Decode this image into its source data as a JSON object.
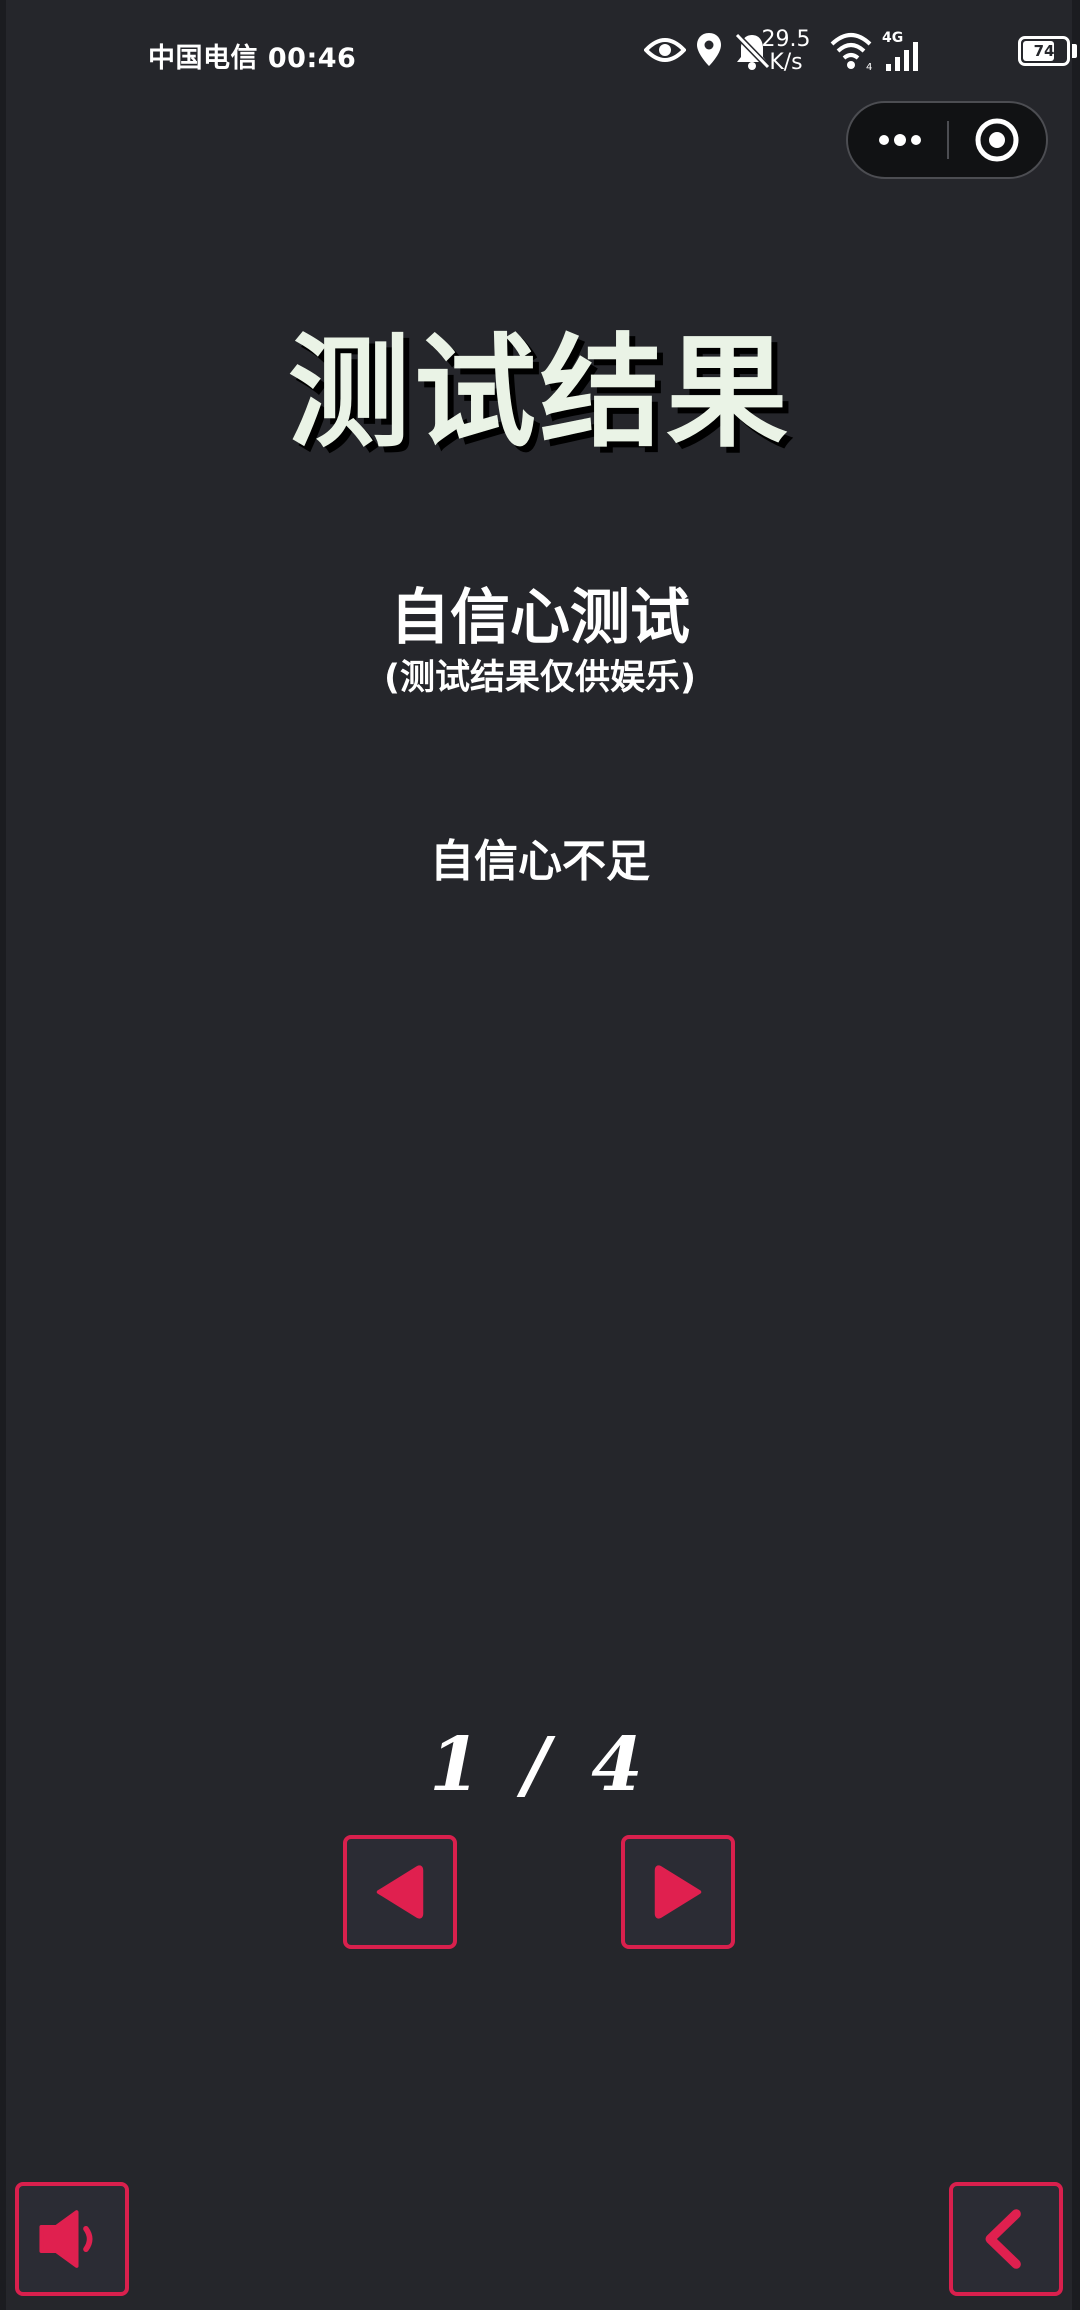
{
  "status_bar": {
    "carrier_time": "中国电信 00:46",
    "net_speed_value": "29.5",
    "net_speed_unit": "K/s",
    "network_type": "4G",
    "battery_level": "74",
    "battery_fraction": 0.74,
    "icons": [
      "eye-icon",
      "location-icon",
      "bell-off-icon",
      "wifi-icon",
      "signal-icon",
      "battery-icon"
    ]
  },
  "capsule": {
    "more_icon": "more-dots-icon",
    "close_icon": "target-circle-icon"
  },
  "main": {
    "title": "测试结果",
    "test_name": "自信心测试",
    "disclaimer": "(测试结果仅供娱乐)",
    "result": "自信心不足"
  },
  "pager": {
    "text": "1 / 4",
    "current": 1,
    "total": 4,
    "prev_icon": "triangle-left-icon",
    "next_icon": "triangle-right-icon"
  },
  "bottom": {
    "sound_icon": "speaker-icon",
    "back_icon": "chevron-left-icon"
  },
  "colors": {
    "background": "#25262b",
    "accent": "#d9204d",
    "title_color": "#eaf3e6",
    "text": "#ffffff"
  }
}
